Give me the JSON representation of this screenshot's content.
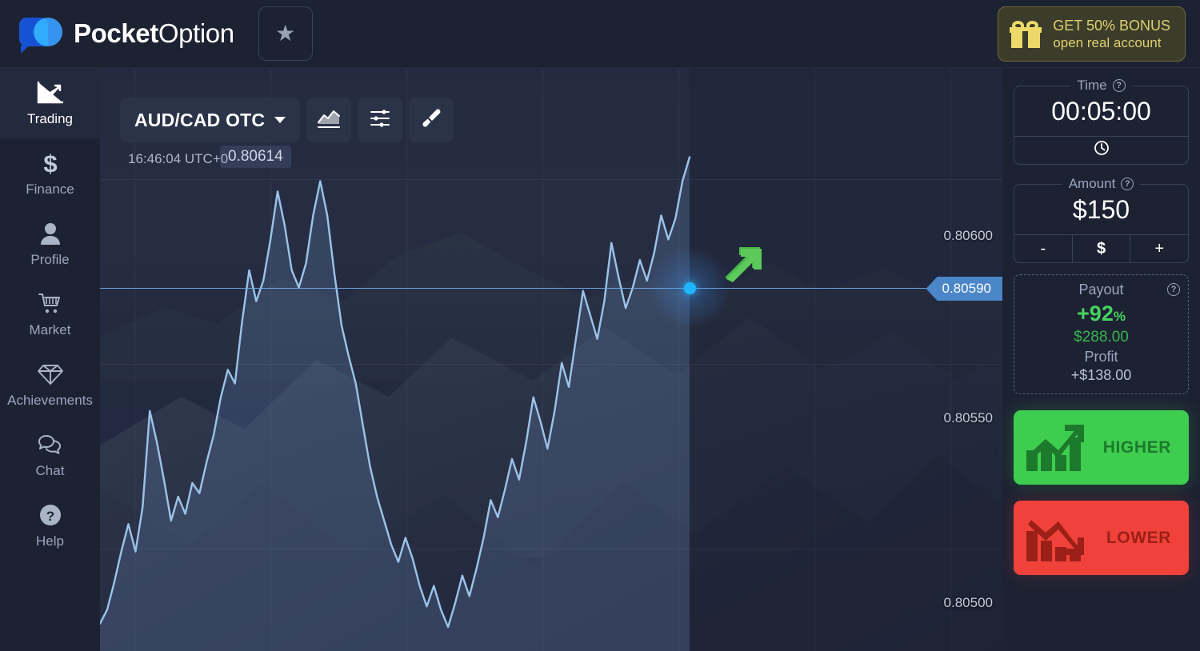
{
  "brand": {
    "name_bold": "Pocket",
    "name_light": "Option",
    "logo_icon": "pocketoption-logo"
  },
  "header": {
    "favorites_icon": "star-icon",
    "bonus": {
      "line1": "GET 50% BONUS",
      "line2": "open real account",
      "icon": "gift-icon"
    }
  },
  "sidebar": {
    "items": [
      {
        "label": "Trading",
        "icon": "chart-line-icon",
        "active": true
      },
      {
        "label": "Finance",
        "icon": "dollar-icon",
        "active": false
      },
      {
        "label": "Profile",
        "icon": "user-icon",
        "active": false
      },
      {
        "label": "Market",
        "icon": "cart-icon",
        "active": false
      },
      {
        "label": "Achievements",
        "icon": "diamond-icon",
        "active": false
      },
      {
        "label": "Chat",
        "icon": "chat-bubble-icon",
        "active": false
      },
      {
        "label": "Help",
        "icon": "question-circle-icon",
        "active": false
      }
    ]
  },
  "chart_toolbar": {
    "asset": "AUD/CAD OTC",
    "dropdown_icon": "chevron-down-icon",
    "chart_type_icon": "area-chart-icon",
    "indicators_icon": "sliders-icon",
    "theme_icon": "brush-icon"
  },
  "chart_overlay": {
    "timestamp": "16:46:04 UTC+0",
    "current_quote": "0.80614",
    "current_price_tag": "0.80590",
    "marker_icon": "current-price-dot",
    "direction_arrow_icon": "green-up-arrow-icon"
  },
  "chart_data": {
    "type": "line",
    "title": "AUD/CAD OTC",
    "ylabel": "",
    "xlabel": "",
    "ylim": [
      0.8047,
      0.8064
    ],
    "yticks": [
      "0.80600",
      "0.80550",
      "0.80500"
    ],
    "ytick_values": [
      0.806,
      0.8055,
      0.805
    ],
    "grid": true,
    "current_price": 0.8059,
    "last_quote": 0.80614,
    "series": [
      {
        "name": "AUD/CAD OTC",
        "line_color": "#9cc3e8",
        "fill_color": "rgba(125,160,215,0.20)",
        "values": [
          0.80478,
          0.80482,
          0.8049,
          0.80499,
          0.80507,
          0.80499,
          0.80512,
          0.8054,
          0.80531,
          0.8052,
          0.80508,
          0.80515,
          0.8051,
          0.80519,
          0.80516,
          0.80525,
          0.80533,
          0.80544,
          0.80552,
          0.80548,
          0.80566,
          0.80581,
          0.80572,
          0.80578,
          0.8059,
          0.80604,
          0.80594,
          0.80581,
          0.80576,
          0.80583,
          0.80597,
          0.80607,
          0.80597,
          0.8058,
          0.80565,
          0.80556,
          0.80548,
          0.80536,
          0.80524,
          0.80515,
          0.80508,
          0.80501,
          0.80496,
          0.80503,
          0.80497,
          0.80489,
          0.80483,
          0.80489,
          0.80482,
          0.80477,
          0.80484,
          0.80492,
          0.80486,
          0.80494,
          0.80503,
          0.80514,
          0.80509,
          0.80517,
          0.80526,
          0.8052,
          0.80531,
          0.80544,
          0.80537,
          0.80529,
          0.8054,
          0.80554,
          0.80547,
          0.80561,
          0.80575,
          0.80568,
          0.80561,
          0.80572,
          0.80589,
          0.80579,
          0.8057,
          0.80576,
          0.80584,
          0.80578,
          0.80586,
          0.80597,
          0.8059,
          0.80596,
          0.80607,
          0.80614
        ]
      }
    ]
  },
  "right_panel": {
    "time": {
      "legend": "Time",
      "help_icon": "question-icon",
      "value": "00:05:00",
      "clock_icon": "clock-icon"
    },
    "amount": {
      "legend": "Amount",
      "help_icon": "question-icon",
      "value": "$150",
      "minus": "-",
      "currency": "$",
      "plus": "+"
    },
    "payout": {
      "title": "Payout",
      "help_icon": "question-icon",
      "percent": "+92",
      "percent_unit": "%",
      "amount": "$288.00",
      "profit_label": "Profit",
      "profit_value": "+$138.00"
    },
    "higher_button": {
      "label": "HIGHER",
      "icon": "arrow-up-chart-icon",
      "color": "#3ecd4f"
    },
    "lower_button": {
      "label": "LOWER",
      "icon": "arrow-down-chart-icon",
      "color": "#f0423a"
    }
  }
}
